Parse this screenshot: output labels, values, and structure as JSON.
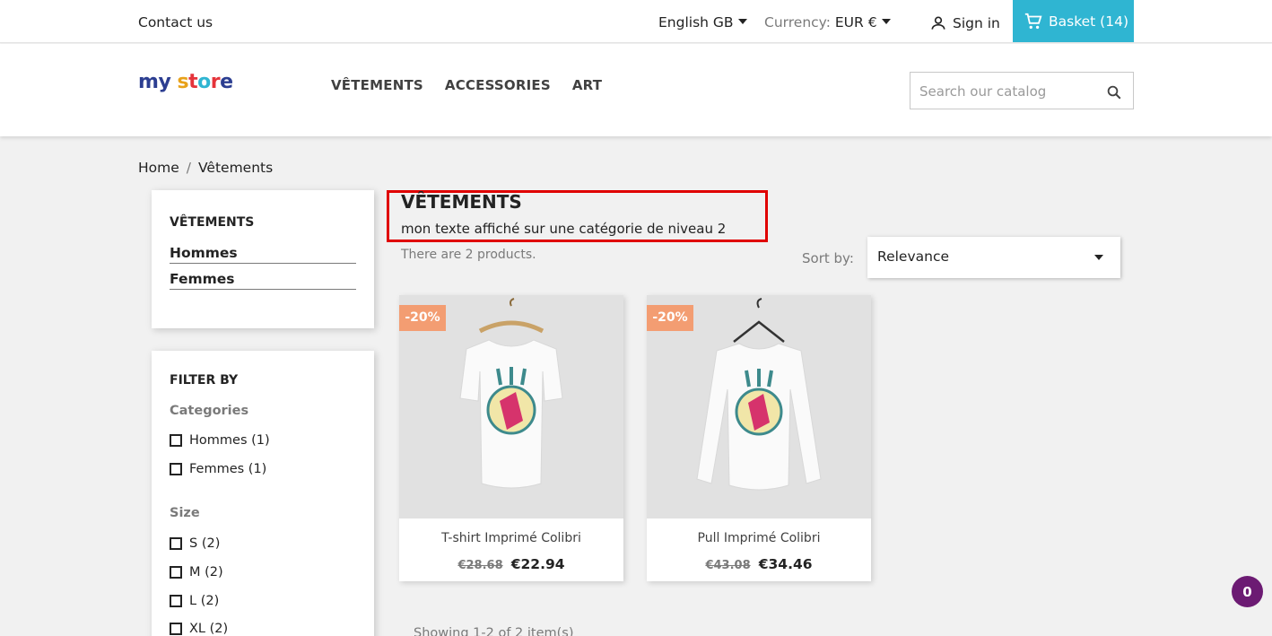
{
  "topbar": {
    "contact": "Contact us",
    "language": "English GB",
    "currency_label": "Currency:",
    "currency_value": "EUR €",
    "signin": "Sign in",
    "basket": "Basket (14)"
  },
  "header": {
    "logo": {
      "parts": [
        "m",
        "y",
        " ",
        "s",
        "t",
        "o",
        "r",
        "e"
      ],
      "colors": [
        "#2c3e91",
        "#2c3e91",
        "#ffffff",
        "#e8a21a",
        "#e5343b",
        "#2fb5d2",
        "#e5343b",
        "#2c3e91"
      ]
    },
    "nav": [
      "VÊTEMENTS",
      "ACCESSORIES",
      "ART"
    ],
    "search_placeholder": "Search our catalog"
  },
  "breadcrumb": {
    "home": "Home",
    "sep": "/",
    "current": "Vêtements"
  },
  "sidebar": {
    "category_title": "VÊTEMENTS",
    "subcategories": [
      "Hommes",
      "Femmes"
    ],
    "filter_title": "FILTER BY",
    "groups": [
      {
        "title": "Categories",
        "options": [
          "Hommes (1)",
          "Femmes (1)"
        ]
      },
      {
        "title": "Size",
        "options": [
          "S (2)",
          "M (2)",
          "L (2)",
          "XL (2)"
        ]
      }
    ]
  },
  "main": {
    "title": "VÊTEMENTS",
    "description": "mon texte affiché sur une catégorie de niveau 2",
    "count": "There are 2 products.",
    "sort_label": "Sort by:",
    "sort_value": "Relevance",
    "products": [
      {
        "name": "T-shirt Imprimé Colibri",
        "discount": "-20%",
        "old_price": "€28.68",
        "price": "€22.94",
        "image_icon": "tshirt-icon"
      },
      {
        "name": "Pull Imprimé Colibri",
        "discount": "-20%",
        "old_price": "€43.08",
        "price": "€34.46",
        "image_icon": "sweater-icon"
      }
    ],
    "pagination": "Showing 1-2 of 2 item(s)"
  },
  "notification_count": "0",
  "colors": {
    "accent": "#2fb5d2",
    "badge": "#f39d72",
    "highlight": "#e00000",
    "bubble": "#6c1b73"
  }
}
